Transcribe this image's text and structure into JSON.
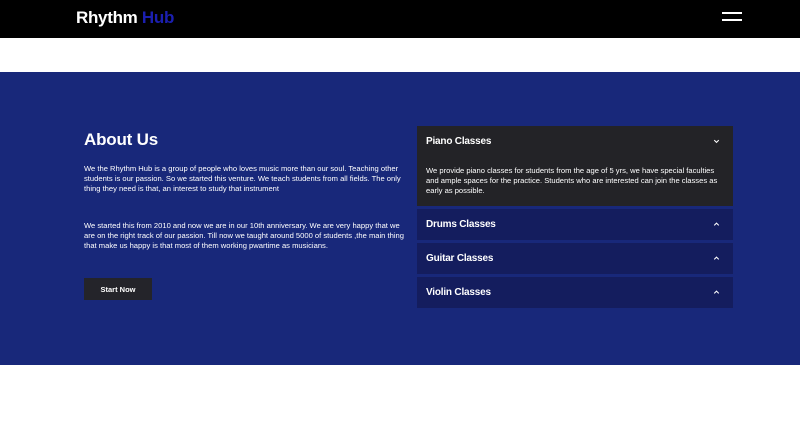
{
  "navbar": {
    "brand_primary": "Rhythm",
    "brand_accent": "Hub"
  },
  "about": {
    "title": "About Us",
    "paragraph1": "We the Rhythm Hub is a group of people who loves music more than our soul. Teaching other students is our passion. So we started this venture. We teach students from all fields. The only thing they need is that, an interest to study that instrument",
    "paragraph2": "We started this from 2010 and now we are in our 10th anniversary. We are very happy that we are on the right track of our passion. Till now we taught around 5000 of students ,the main thing that make us happy is that most of them working pwartime as musicians.",
    "button_label": "Start Now"
  },
  "accordion": {
    "items": [
      {
        "title": "Piano Classes",
        "expanded": true,
        "chevron": "chevron-down-icon",
        "body": "We provide piano classes for students from the age of 5 yrs, we have special faculties and ample spaces for the practice. Students who are interested can join the classes as early as possible."
      },
      {
        "title": "Drums Classes",
        "expanded": false,
        "chevron": "chevron-up-icon"
      },
      {
        "title": "Guitar Classes",
        "expanded": false,
        "chevron": "chevron-up-icon"
      },
      {
        "title": "Violin Classes",
        "expanded": false,
        "chevron": "chevron-up-icon"
      }
    ]
  },
  "colors": {
    "navbar_bg": "#000000",
    "brand_accent": "#1b1fb0",
    "section_bg": "#18287a",
    "accordion_closed_bg": "#141d5e",
    "accordion_open_bg": "#232327"
  }
}
